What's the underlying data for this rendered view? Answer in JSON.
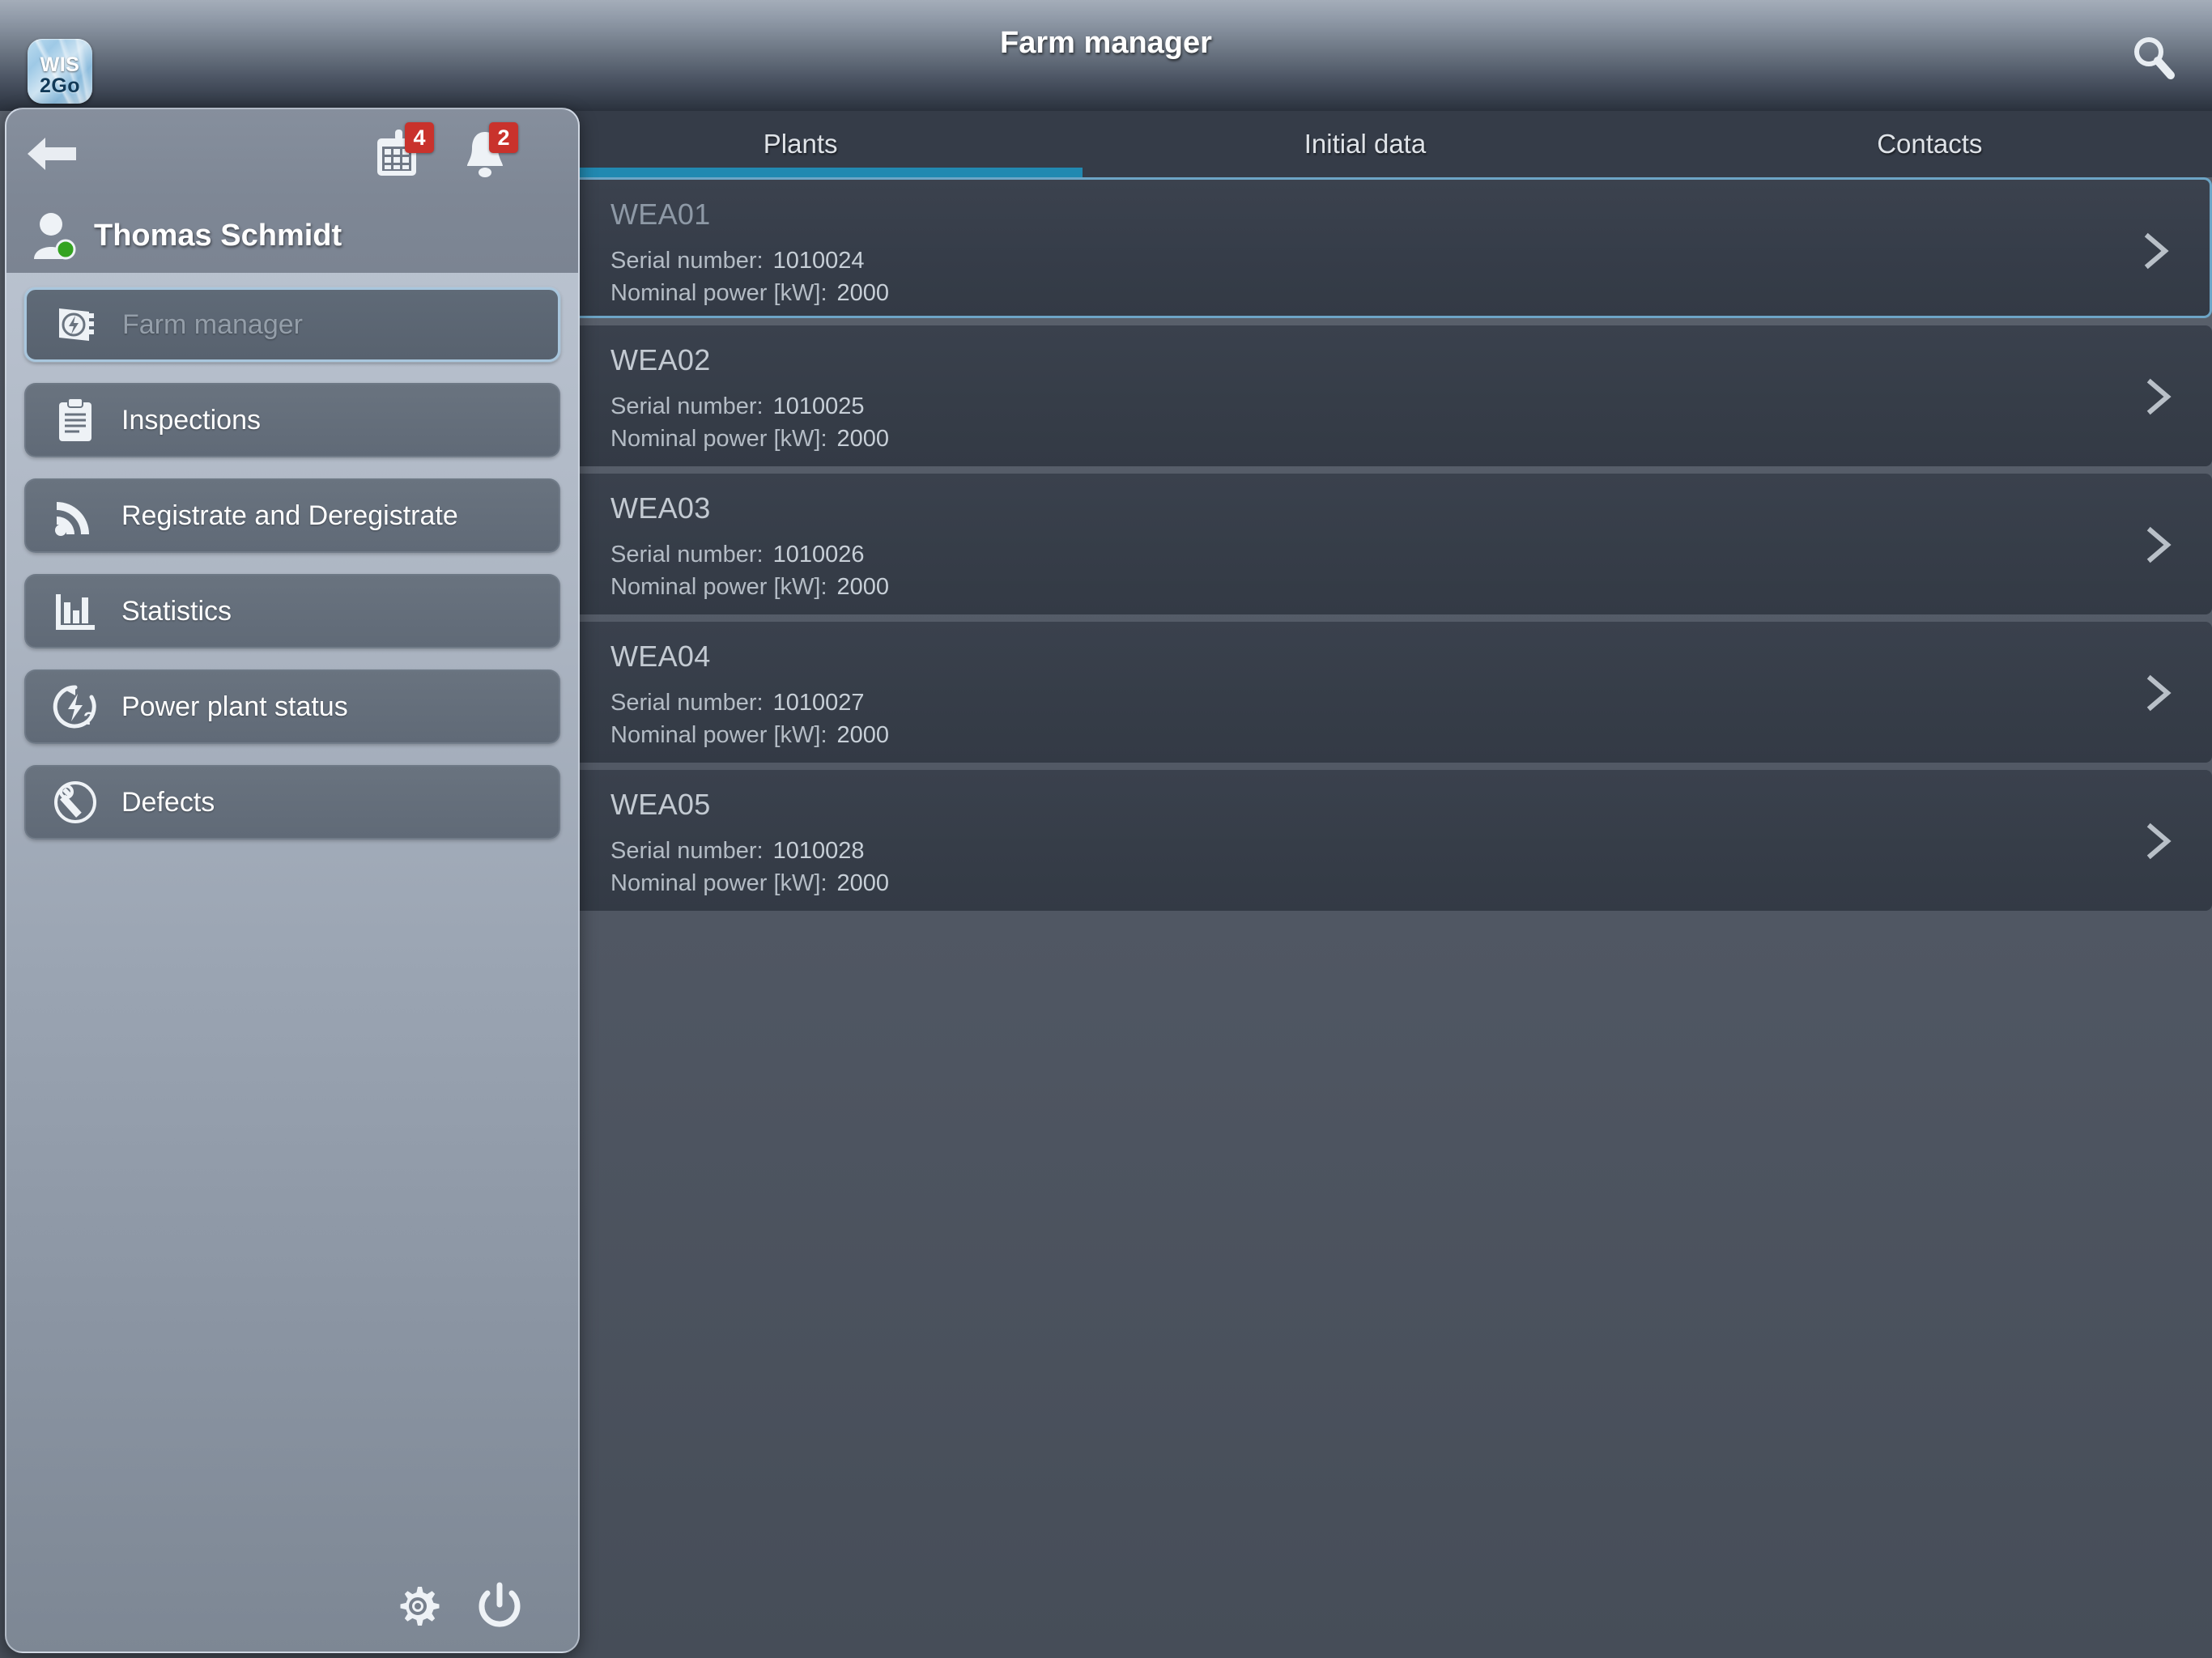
{
  "app": {
    "logo_line1": "WIS",
    "logo_line2": "2Go",
    "logo_name": "wis2go-logo"
  },
  "header": {
    "title": "Farm manager",
    "search_icon": "search-icon"
  },
  "tabs": [
    {
      "label": "Plants",
      "active": true
    },
    {
      "label": "Initial data",
      "active": false
    },
    {
      "label": "Contacts",
      "active": false
    }
  ],
  "sidebar": {
    "back_icon": "back-arrow-icon",
    "calendar": {
      "icon": "calendar-icon",
      "badge": "4"
    },
    "notifications": {
      "icon": "bell-icon",
      "badge": "2"
    },
    "user": {
      "name": "Thomas Schmidt",
      "avatar_icon": "user-avatar-icon",
      "status_color": "#34a320"
    },
    "items": [
      {
        "label": "Farm manager",
        "icon": "farm-manager-icon",
        "active": true
      },
      {
        "label": "Inspections",
        "icon": "clipboard-icon",
        "active": false
      },
      {
        "label": "Registrate and Deregistrate",
        "icon": "rss-signal-icon",
        "active": false
      },
      {
        "label": "Statistics",
        "icon": "bar-chart-icon",
        "active": false
      },
      {
        "label": "Power plant status",
        "icon": "power-status-icon",
        "active": false
      },
      {
        "label": "Defects",
        "icon": "wrench-icon",
        "active": false
      }
    ],
    "footer": {
      "settings_icon": "gear-icon",
      "power_icon": "power-icon"
    }
  },
  "plants": {
    "serial_label": "Serial number:",
    "power_label": "Nominal power [kW]:",
    "rows": [
      {
        "name": "WEA01",
        "serial": "1010024",
        "power": "2000",
        "selected": true
      },
      {
        "name": "WEA02",
        "serial": "1010025",
        "power": "2000",
        "selected": false
      },
      {
        "name": "WEA03",
        "serial": "1010026",
        "power": "2000",
        "selected": false
      },
      {
        "name": "WEA04",
        "serial": "1010027",
        "power": "2000",
        "selected": false
      },
      {
        "name": "WEA05",
        "serial": "1010028",
        "power": "2000",
        "selected": false
      }
    ]
  },
  "colors": {
    "accent": "#2189b1",
    "badge": "#c9322c",
    "selected_border": "#6da5c6",
    "row_bg": "#373e4a"
  }
}
